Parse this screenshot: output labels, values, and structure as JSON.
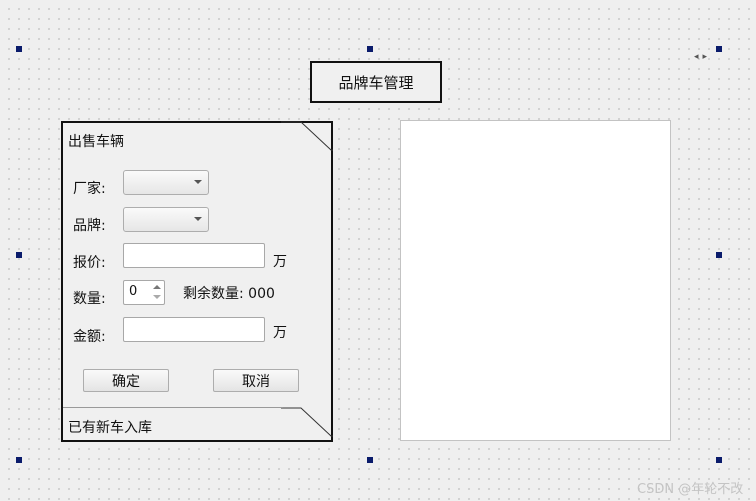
{
  "header": {
    "title": "品牌车管理"
  },
  "sale_panel": {
    "section_title": "出售车辆",
    "manufacturer_label": "厂家:",
    "manufacturer_value": "",
    "brand_label": "品牌:",
    "brand_value": "",
    "price_label": "报价:",
    "price_value": "",
    "price_unit": "万",
    "quantity_label": "数量:",
    "quantity_value": "0",
    "remaining_text": "剩余数量: 000",
    "amount_label": "金额:",
    "amount_value": "",
    "amount_unit": "万",
    "confirm_label": "确定",
    "cancel_label": "取消"
  },
  "stock_panel": {
    "section_title": "已有新车入库"
  },
  "watermark": "CSDN @年轮不改",
  "colors": {
    "selection_handle": "#0a1b6b",
    "frame_border": "#111111",
    "canvas_background": "#efefef"
  }
}
